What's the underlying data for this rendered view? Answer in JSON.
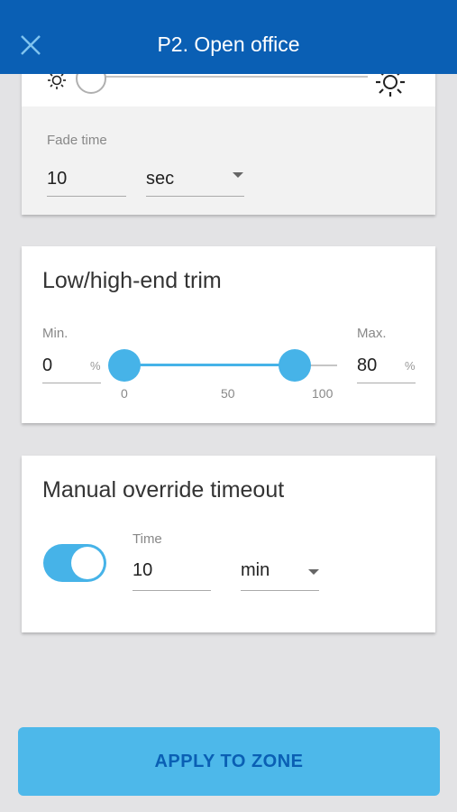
{
  "header": {
    "title": "P2. Open office",
    "close_icon": "close-icon"
  },
  "brightness": {
    "min_icon": "sun-dim-icon",
    "max_icon": "sun-bright-icon",
    "level_percent": 0
  },
  "fade_time": {
    "label": "Fade time",
    "value": "10",
    "unit": "sec"
  },
  "trim": {
    "title": "Low/high-end trim",
    "min_label": "Min.",
    "min_value": "0",
    "max_label": "Max.",
    "max_value": "80",
    "unit": "%",
    "ticks": [
      "0",
      "50",
      "100"
    ],
    "low": 0,
    "high": 80
  },
  "override": {
    "title": "Manual override timeout",
    "toggle_on": true,
    "time_label": "Time",
    "time_value": "10",
    "time_unit": "min"
  },
  "apply_button": "APPLY TO ZONE",
  "colors": {
    "header": "#0a5fb4",
    "accent": "#46b3e8",
    "button": "#4db8ea",
    "button_text": "#0a5fb4"
  }
}
